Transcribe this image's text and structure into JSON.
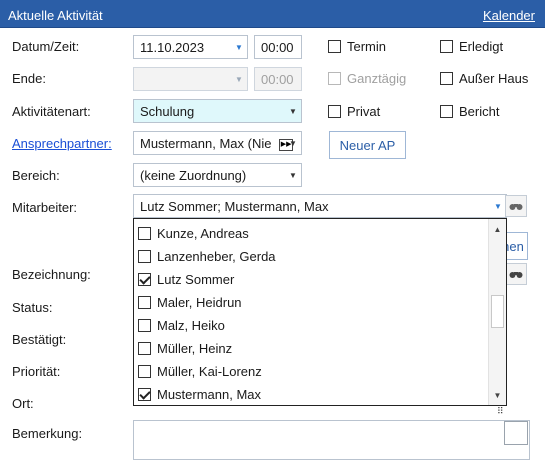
{
  "header": {
    "title": "Aktuelle Aktivität",
    "link": "Kalender"
  },
  "labels": {
    "datum": "Datum/Zeit:",
    "ende": "Ende:",
    "art": "Aktivitätenart:",
    "ansprechpartner": "Ansprechpartner:",
    "bereich": "Bereich:",
    "mitarbeiter": "Mitarbeiter:",
    "bezeichnung": "Bezeichnung:",
    "status": "Status:",
    "bestaetigt": "Bestätigt:",
    "prioritaet": "Priorität:",
    "ort": "Ort:",
    "bemerkung": "Bemerkung:"
  },
  "fields": {
    "datum": "11.10.2023",
    "zeit": "00:00",
    "ende_zeit": "00:00",
    "art": "Schulung",
    "ansprechpartner": "Mustermann, Max (Nie",
    "bereich": "(keine Zuordnung)",
    "mitarbeiter": "Lutz Sommer; Mustermann, Max"
  },
  "checkboxes": {
    "termin": "Termin",
    "erledigt": "Erledigt",
    "ganztaegig": "Ganztägig",
    "ausser_haus": "Außer Haus",
    "privat": "Privat",
    "bericht": "Bericht"
  },
  "buttons": {
    "neuer_ap": "Neuer AP",
    "partial": "hen"
  },
  "dropdown": {
    "items": [
      {
        "label": "Kunze, Andreas",
        "checked": false
      },
      {
        "label": "Lanzenheber, Gerda",
        "checked": false
      },
      {
        "label": "Lutz Sommer",
        "checked": true
      },
      {
        "label": "Maler, Heidrun",
        "checked": false
      },
      {
        "label": "Malz, Heiko",
        "checked": false
      },
      {
        "label": "Müller, Heinz",
        "checked": false
      },
      {
        "label": "Müller, Kai-Lorenz",
        "checked": false
      },
      {
        "label": "Mustermann, Max",
        "checked": true
      }
    ]
  },
  "colors": {
    "header": "#2b5ea7",
    "link": "#1a4fd6",
    "cyan_field": "#dff8fb"
  }
}
